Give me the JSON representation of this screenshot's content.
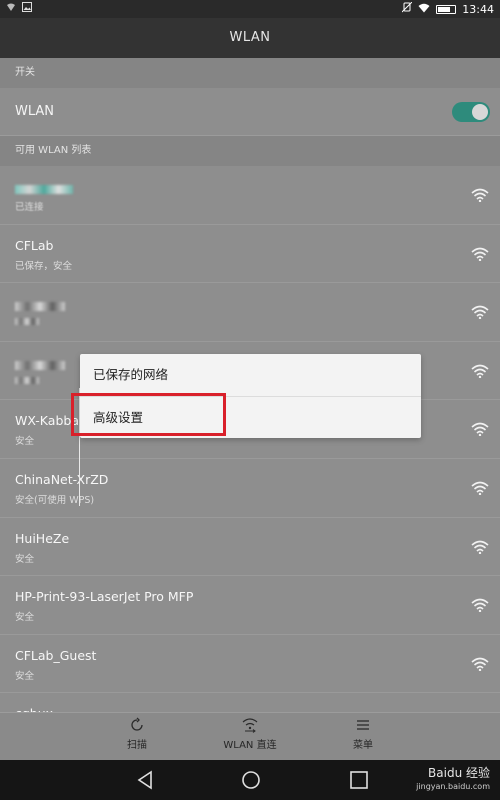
{
  "status_bar": {
    "time": "13:44",
    "left_icons": [
      "wifi-signal-icon",
      "image-icon"
    ],
    "right_icons": [
      "alarm-icon",
      "wifi-icon",
      "battery-icon"
    ]
  },
  "app_bar": {
    "title": "WLAN"
  },
  "switch_section": {
    "header": "开关",
    "label": "WLAN",
    "enabled": true
  },
  "list_section": {
    "header": "可用 WLAN 列表"
  },
  "networks": [
    {
      "name": "",
      "status": "已连接",
      "obscured": true
    },
    {
      "name": "CFLab",
      "status": "已保存，安全"
    },
    {
      "name": "",
      "status": "",
      "obscured": true
    },
    {
      "name": "",
      "status": "",
      "obscured": true
    },
    {
      "name": "WX-Kabba",
      "status": "安全"
    },
    {
      "name": "ChinaNet-XrZD",
      "status": "安全(可使用 WPS)"
    },
    {
      "name": "HuiHeZe",
      "status": "安全"
    },
    {
      "name": "HP-Print-93-LaserJet Pro MFP",
      "status": "安全"
    },
    {
      "name": "CFLab_Guest",
      "status": "安全"
    },
    {
      "name": "cqbux",
      "status": ""
    }
  ],
  "popup_menu": {
    "items": [
      "已保存的网络",
      "高级设置"
    ],
    "highlighted": "高级设置",
    "highlight_color": "#d9202a"
  },
  "bottom_actions": [
    {
      "label": "扫描",
      "icon": "refresh-icon"
    },
    {
      "label": "WLAN 直连",
      "icon": "wifi-direct-icon"
    },
    {
      "label": "菜单",
      "icon": "menu-icon"
    }
  ],
  "nav": {
    "icons": [
      "back-icon",
      "home-icon",
      "recents-icon"
    ]
  },
  "watermark": {
    "text": "Baidu 经验",
    "sub": "jingyan.baidu.com"
  },
  "colors": {
    "switch_on": "#2e8b7c",
    "highlight": "#d9202a"
  }
}
